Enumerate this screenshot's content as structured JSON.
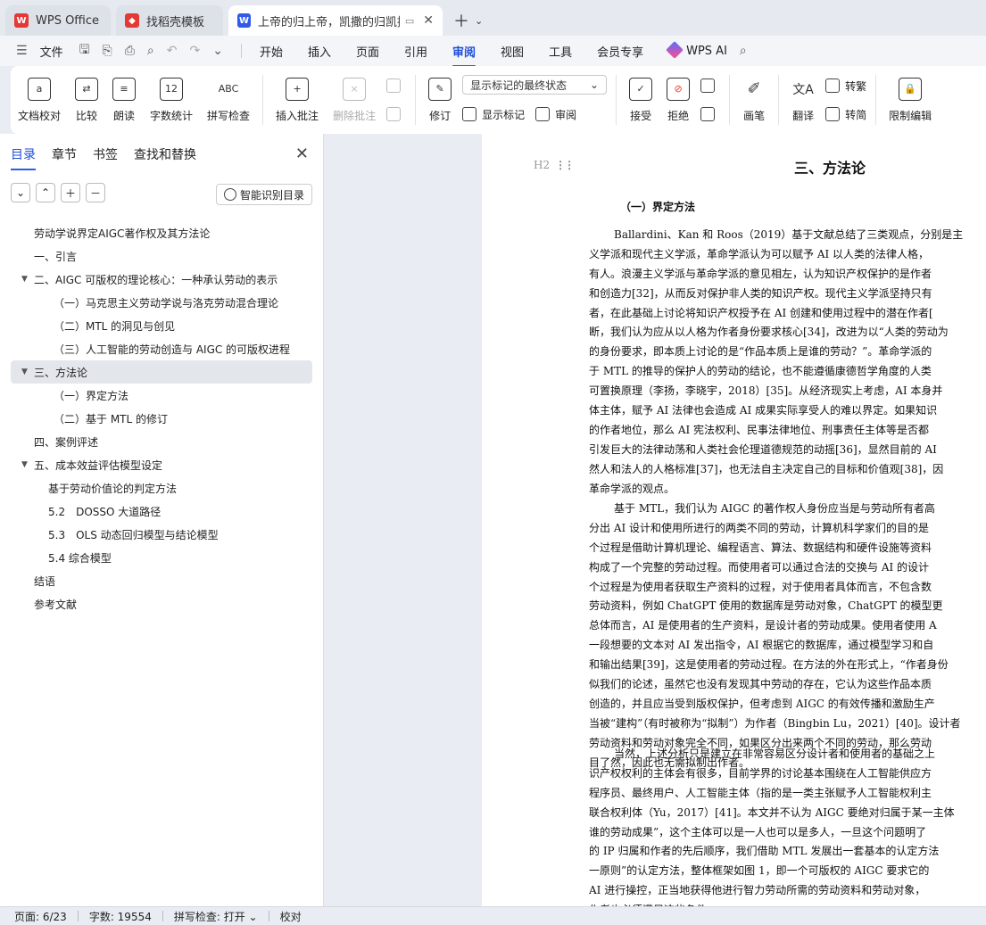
{
  "tabs": [
    {
      "label": "WPS Office",
      "icon": "wps-logo-icon",
      "color": "#e53935"
    },
    {
      "label": "找稻壳模板",
      "icon": "docer-icon",
      "color": "#e53935"
    },
    {
      "label": "上帝的归上帝，凯撒的归凯撒",
      "icon": "writer-doc-icon",
      "color": "#2f5be8"
    }
  ],
  "menu": {
    "file": "文件",
    "items": [
      "开始",
      "插入",
      "页面",
      "引用",
      "审阅",
      "视图",
      "工具",
      "会员专享"
    ],
    "active": "审阅",
    "ai": "WPS AI"
  },
  "ribbon": {
    "doc_check": "文档校对",
    "compare": "比较",
    "read_aloud": "朗读",
    "word_count": "字数统计",
    "word_count_icon_text": "12",
    "spell_check": "拼写检查",
    "spell_icon_text": "ABC",
    "insert_comment": "插入批注",
    "delete_comment": "删除批注",
    "revise": "修订",
    "markup_mode": "显示标记的最终状态",
    "show_markup": "显示标记",
    "review": "审阅",
    "accept": "接受",
    "reject": "拒绝",
    "pen": "画笔",
    "translate": "翻译",
    "to_traditional": "转繁",
    "to_simplified": "转简",
    "restrict_edit": "限制编辑"
  },
  "nav": {
    "tabs": [
      "目录",
      "章节",
      "书签",
      "查找和替换"
    ],
    "active_tab": "目录",
    "smart_toc": "智能识别目录",
    "toc": [
      {
        "text": "劳动学说界定AIGC著作权及其方法论",
        "level": 0,
        "arrow": false,
        "sel": false
      },
      {
        "text": "一、引言",
        "level": 0,
        "arrow": false,
        "sel": false
      },
      {
        "text": "二、AIGC 可版权的理论核心：一种承认劳动的表示",
        "level": 0,
        "arrow": true,
        "sel": false
      },
      {
        "text": "（一）马克思主义劳动学说与洛克劳动混合理论",
        "level": 1,
        "arrow": false,
        "sel": false
      },
      {
        "text": "（二）MTL 的洞见与创见",
        "level": 1,
        "arrow": false,
        "sel": false
      },
      {
        "text": "（三）人工智能的劳动创造与 AIGC 的可版权进程",
        "level": 1,
        "arrow": false,
        "sel": false
      },
      {
        "text": "三、方法论",
        "level": 0,
        "arrow": true,
        "sel": true
      },
      {
        "text": "（一）界定方法",
        "level": 1,
        "arrow": false,
        "sel": false
      },
      {
        "text": "（二）基于 MTL 的修订",
        "level": 1,
        "arrow": false,
        "sel": false
      },
      {
        "text": "四、案例评述",
        "level": 0,
        "arrow": false,
        "sel": false
      },
      {
        "text": "五、成本效益评估模型设定",
        "level": 0,
        "arrow": true,
        "sel": false
      },
      {
        "text": "基于劳动价值论的判定方法",
        "level": 2,
        "arrow": false,
        "sel": false
      },
      {
        "text": "5.2　DOSSO 大道路径",
        "level": 2,
        "arrow": false,
        "sel": false
      },
      {
        "text": "5.3　OLS 动态回归模型与结论模型",
        "level": 2,
        "arrow": false,
        "sel": false
      },
      {
        "text": "5.4 综合模型",
        "level": 2,
        "arrow": false,
        "sel": false
      },
      {
        "text": "结语",
        "level": 0,
        "arrow": false,
        "sel": false
      },
      {
        "text": "参考文献",
        "level": 0,
        "arrow": false,
        "sel": false
      }
    ]
  },
  "doc": {
    "heading_tag": "H2",
    "title": "三、方法论",
    "subtitle": "（一）界定方法",
    "paragraphs": [
      [
        "Ballardini、Kan 和 Roos（2019）基于文献总结了三类观点，分别是主",
        "义学派和现代主义学派，革命学派认为可以赋予 AI 以人类的法律人格，",
        "有人。浪漫主义学派与革命学派的意见相左，认为知识产权保护的是作者",
        "和创造力[32]，从而反对保护非人类的知识产权。现代主义学派坚持只有",
        "者，在此基础上讨论将知识产权授予在 AI 创建和使用过程中的潜在作者[",
        "断，我们认为应从以人格为作者身份要求核心[34]，改进为以“人类的劳动为",
        "的身份要求，即本质上讨论的是“作品本质上是谁的劳动？”。革命学派的",
        "于 MTL 的推导的保护人的劳动的结论，也不能遵循康德哲学角度的人类",
        "可置换原理（李扬，李晓宇，2018）[35]。从经济现实上考虑，AI 本身并",
        "体主体，赋予 AI 法律也会造成 AI 成果实际享受人的难以界定。如果知识",
        "的作者地位，那么 AI 宪法权利、民事法律地位、刑事责任主体等是否都",
        "引发巨大的法律动荡和人类社会伦理道德规范的动摇[36]，显然目前的 AI",
        "然人和法人的人格标准[37]，也无法自主决定自己的目标和价值观[38]，因",
        "革命学派的观点。"
      ],
      [
        "基于 MTL，我们认为 AIGC 的著作权人身份应当是与劳动所有者高",
        "分出 AI 设计和使用所进行的两类不同的劳动，计算机科学家们的目的是",
        "个过程是借助计算机理论、编程语言、算法、数据结构和硬件设施等资料",
        "构成了一个完整的劳动过程。而使用者可以通过合法的交换与 AI 的设计",
        "个过程是为使用者获取生产资料的过程，对于使用者具体而言，不包含数",
        "劳动资料，例如 ChatGPT 使用的数据库是劳动对象，ChatGPT 的模型更",
        "总体而言，AI 是使用者的生产资料，是设计者的劳动成果。使用者使用 A",
        "一段想要的文本对 AI 发出指令，AI 根据它的数据库，通过模型学习和自",
        "和输出结果[39]，这是使用者的劳动过程。在方法的外在形式上，“作者身份",
        "似我们的论述，虽然它也没有发现其中劳动的存在，它认为这些作品本质",
        "创造的，并且应当受到版权保护，但考虑到 AIGC 的有效传播和激励生产",
        "当被“建构”（有时被称为“拟制”）为作者（Bingbin Lu，2021）[40]。设计者",
        "劳动资料和劳动对象完全不同，如果区分出来两个不同的劳动，那么劳动",
        "目了然，因此也无需拟制出作者。"
      ],
      [
        "当然，上述分析只是建立在非常容易区分设计者和使用者的基础之上",
        "识产权权利的主体会有很多，目前学界的讨论基本围绕在人工智能供应方",
        "程序员、最终用户、人工智能主体（指的是一类主张赋予人工智能权利主",
        "联合权利体（Yu，2017）[41]。本文并不认为 AIGC 要绝对归属于某一主体",
        "谁的劳动成果”，这个主体可以是一人也可以是多人，一旦这个问题明了",
        "的 IP 归属和作者的先后顺序，我们借助 MTL 发展出一套基本的认定方法",
        "一原则”的认定方法，整体框架如图 1，即一个可版权的 AIGC 要求它的",
        "AI 进行操控，正当地获得他进行智力劳动所需的劳动资料和劳动对象，",
        "作者也必须满足这些条件。"
      ]
    ]
  },
  "status": {
    "page": "页面: 6/23",
    "words": "字数: 19554",
    "spell": "拼写检查: 打开",
    "proof": "校对"
  }
}
